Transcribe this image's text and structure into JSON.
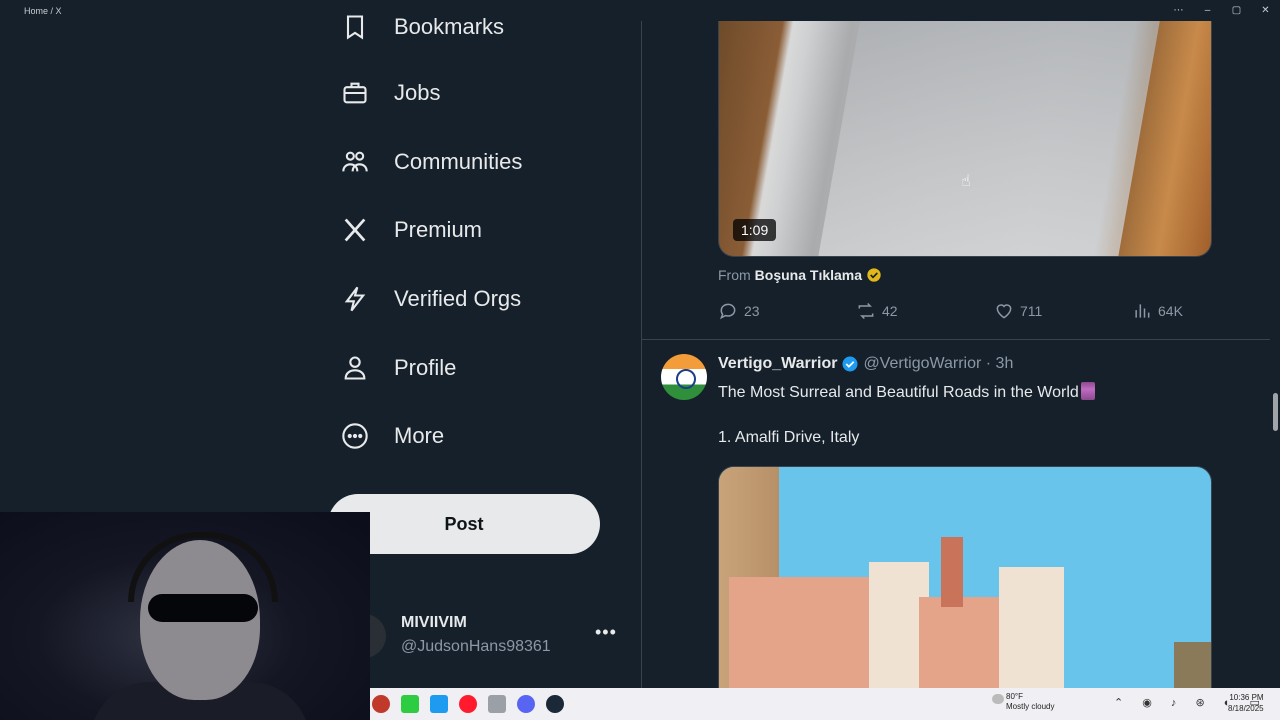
{
  "window": {
    "title": "Home / X",
    "controls": [
      "⋯",
      "–",
      "▢",
      "✕"
    ]
  },
  "nav": {
    "items": [
      {
        "label": "Bookmarks",
        "icon": "bookmark-icon"
      },
      {
        "label": "Jobs",
        "icon": "briefcase-icon"
      },
      {
        "label": "Communities",
        "icon": "people-icon"
      },
      {
        "label": "Premium",
        "icon": "x-logo-icon"
      },
      {
        "label": "Verified Orgs",
        "icon": "lightning-icon"
      },
      {
        "label": "Profile",
        "icon": "person-icon"
      },
      {
        "label": "More",
        "icon": "more-circle-icon"
      }
    ],
    "post_label": "Post"
  },
  "account": {
    "name": "MIVIIVIM",
    "handle": "@JudsonHans98361",
    "more": "•••"
  },
  "tweet1": {
    "video_duration": "1:09",
    "from_prefix": "From",
    "from_name": "Boşuna Tıklama",
    "replies": "23",
    "reposts": "42",
    "likes": "711",
    "views": "64K"
  },
  "tweet2": {
    "name": "Vertigo_Warrior",
    "handle_time": "@VertigoWarrior · 3h",
    "text": "The Most Surreal and Beautiful Roads in the World",
    "line2": "1. Amalfi Drive, Italy"
  },
  "taskbar": {
    "weather_temp": "80°F",
    "weather_desc": "Mostly cloudy",
    "time": "10:36 PM",
    "date": "8/18/2025",
    "tray": "⌃ ◉ ♪ ⊛ ◐ ▭"
  },
  "colors": {
    "background": "#15202b",
    "text": "#e7e9ea",
    "muted": "#8b98a5",
    "divider": "#38444d",
    "verified_blue": "#1d9bf0",
    "verified_gold": "#e2b719"
  }
}
